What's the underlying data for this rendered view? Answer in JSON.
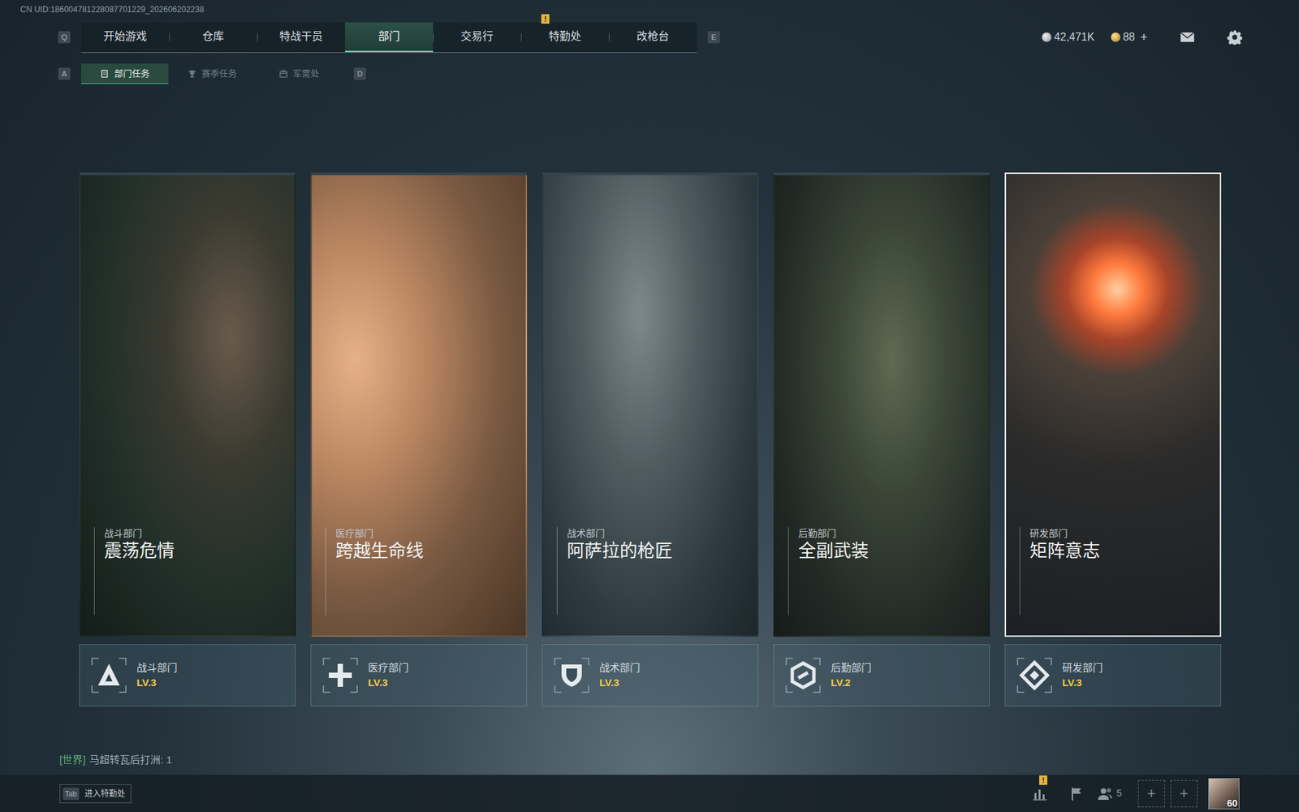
{
  "uid": "CN UID:186004781228087701229_202606202238",
  "nav": {
    "left_key": "Q",
    "right_key": "E",
    "tabs": [
      {
        "label": "开始游戏",
        "selected": false,
        "badge": ""
      },
      {
        "label": "仓库",
        "selected": false,
        "badge": ""
      },
      {
        "label": "特战干员",
        "selected": false,
        "badge": ""
      },
      {
        "label": "部门",
        "selected": true,
        "badge": ""
      },
      {
        "label": "交易行",
        "selected": false,
        "badge": ""
      },
      {
        "label": "特勤处",
        "selected": false,
        "badge": "!"
      },
      {
        "label": "改枪台",
        "selected": false,
        "badge": ""
      }
    ]
  },
  "currency": {
    "silver": "42,471K",
    "gold": "88",
    "add": "+"
  },
  "subnav": {
    "left_key": "A",
    "right_key": "D",
    "tabs": [
      {
        "label": "部门任务",
        "selected": true
      },
      {
        "label": "赛季任务",
        "selected": false
      },
      {
        "label": "军需处",
        "selected": false
      }
    ]
  },
  "departments": [
    {
      "category": "战斗部门",
      "title": "震荡危情",
      "name": "战斗部门",
      "level": "LV.3",
      "selected": false
    },
    {
      "category": "医疗部门",
      "title": "跨越生命线",
      "name": "医疗部门",
      "level": "LV.3",
      "selected": false
    },
    {
      "category": "战术部门",
      "title": "阿萨拉的枪匠",
      "name": "战术部门",
      "level": "LV.3",
      "selected": false
    },
    {
      "category": "后勤部门",
      "title": "全副武装",
      "name": "后勤部门",
      "level": "LV.2",
      "selected": false
    },
    {
      "category": "研发部门",
      "title": "矩阵意志",
      "name": "研发部门",
      "level": "LV.3",
      "selected": true
    }
  ],
  "chat": {
    "channel": "[世界]",
    "message": "马超转瓦后打洲: 1"
  },
  "bottom_bar": {
    "key": "Tab",
    "label": "进入特勤处",
    "stats_badge": "!",
    "friends_count": "5",
    "slots": [
      "+",
      "+"
    ],
    "player_level": "60"
  }
}
